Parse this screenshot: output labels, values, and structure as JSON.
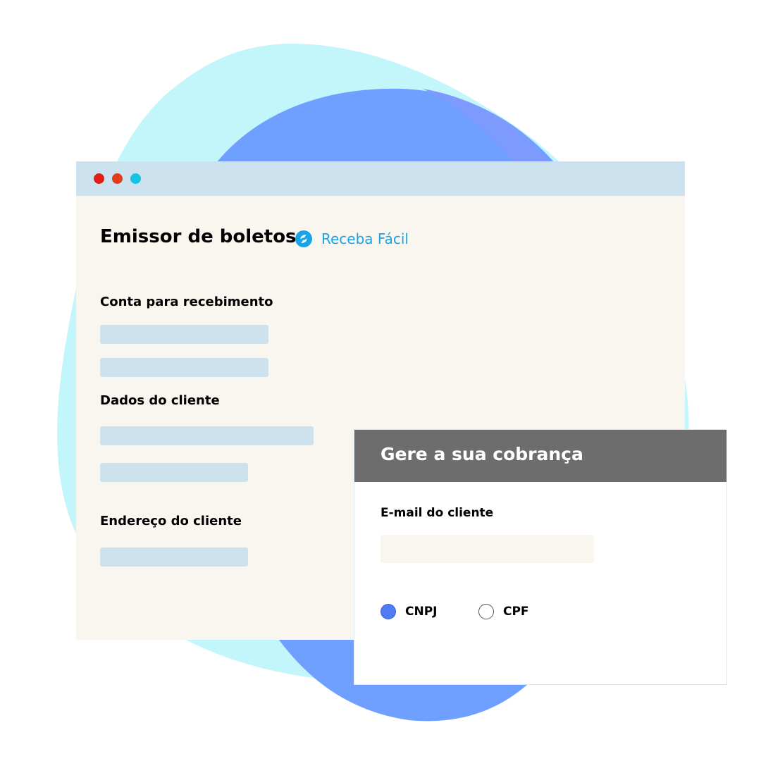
{
  "window": {
    "controls": [
      {
        "name": "close",
        "color": "#e02018"
      },
      {
        "name": "minimize",
        "color": "#e23d1a"
      },
      {
        "name": "maximize",
        "color": "#16c3e0"
      }
    ]
  },
  "header": {
    "title": "Emissor de boletos",
    "brand_name": "Receba Fácil",
    "brand_icon": "receba-facil-logo-icon",
    "brand_color": "#1aa4e8"
  },
  "form": {
    "sections": [
      {
        "label": "Conta para recebimento"
      },
      {
        "label": "Dados do cliente"
      },
      {
        "label": "Endereço do cliente"
      }
    ]
  },
  "modal": {
    "title": "Gere a sua cobrança",
    "email_label": "E-mail do cliente",
    "email_value": "",
    "document_type": {
      "options": [
        "CNPJ",
        "CPF"
      ],
      "selected": "CNPJ"
    }
  },
  "colors": {
    "accent": "#4f7cf5",
    "placeholder": "#cce2ef",
    "modal_header": "#6d6d6d",
    "background_blob_light": "#c2f6fb",
    "background_blob_dark": "#6fa0ff"
  }
}
